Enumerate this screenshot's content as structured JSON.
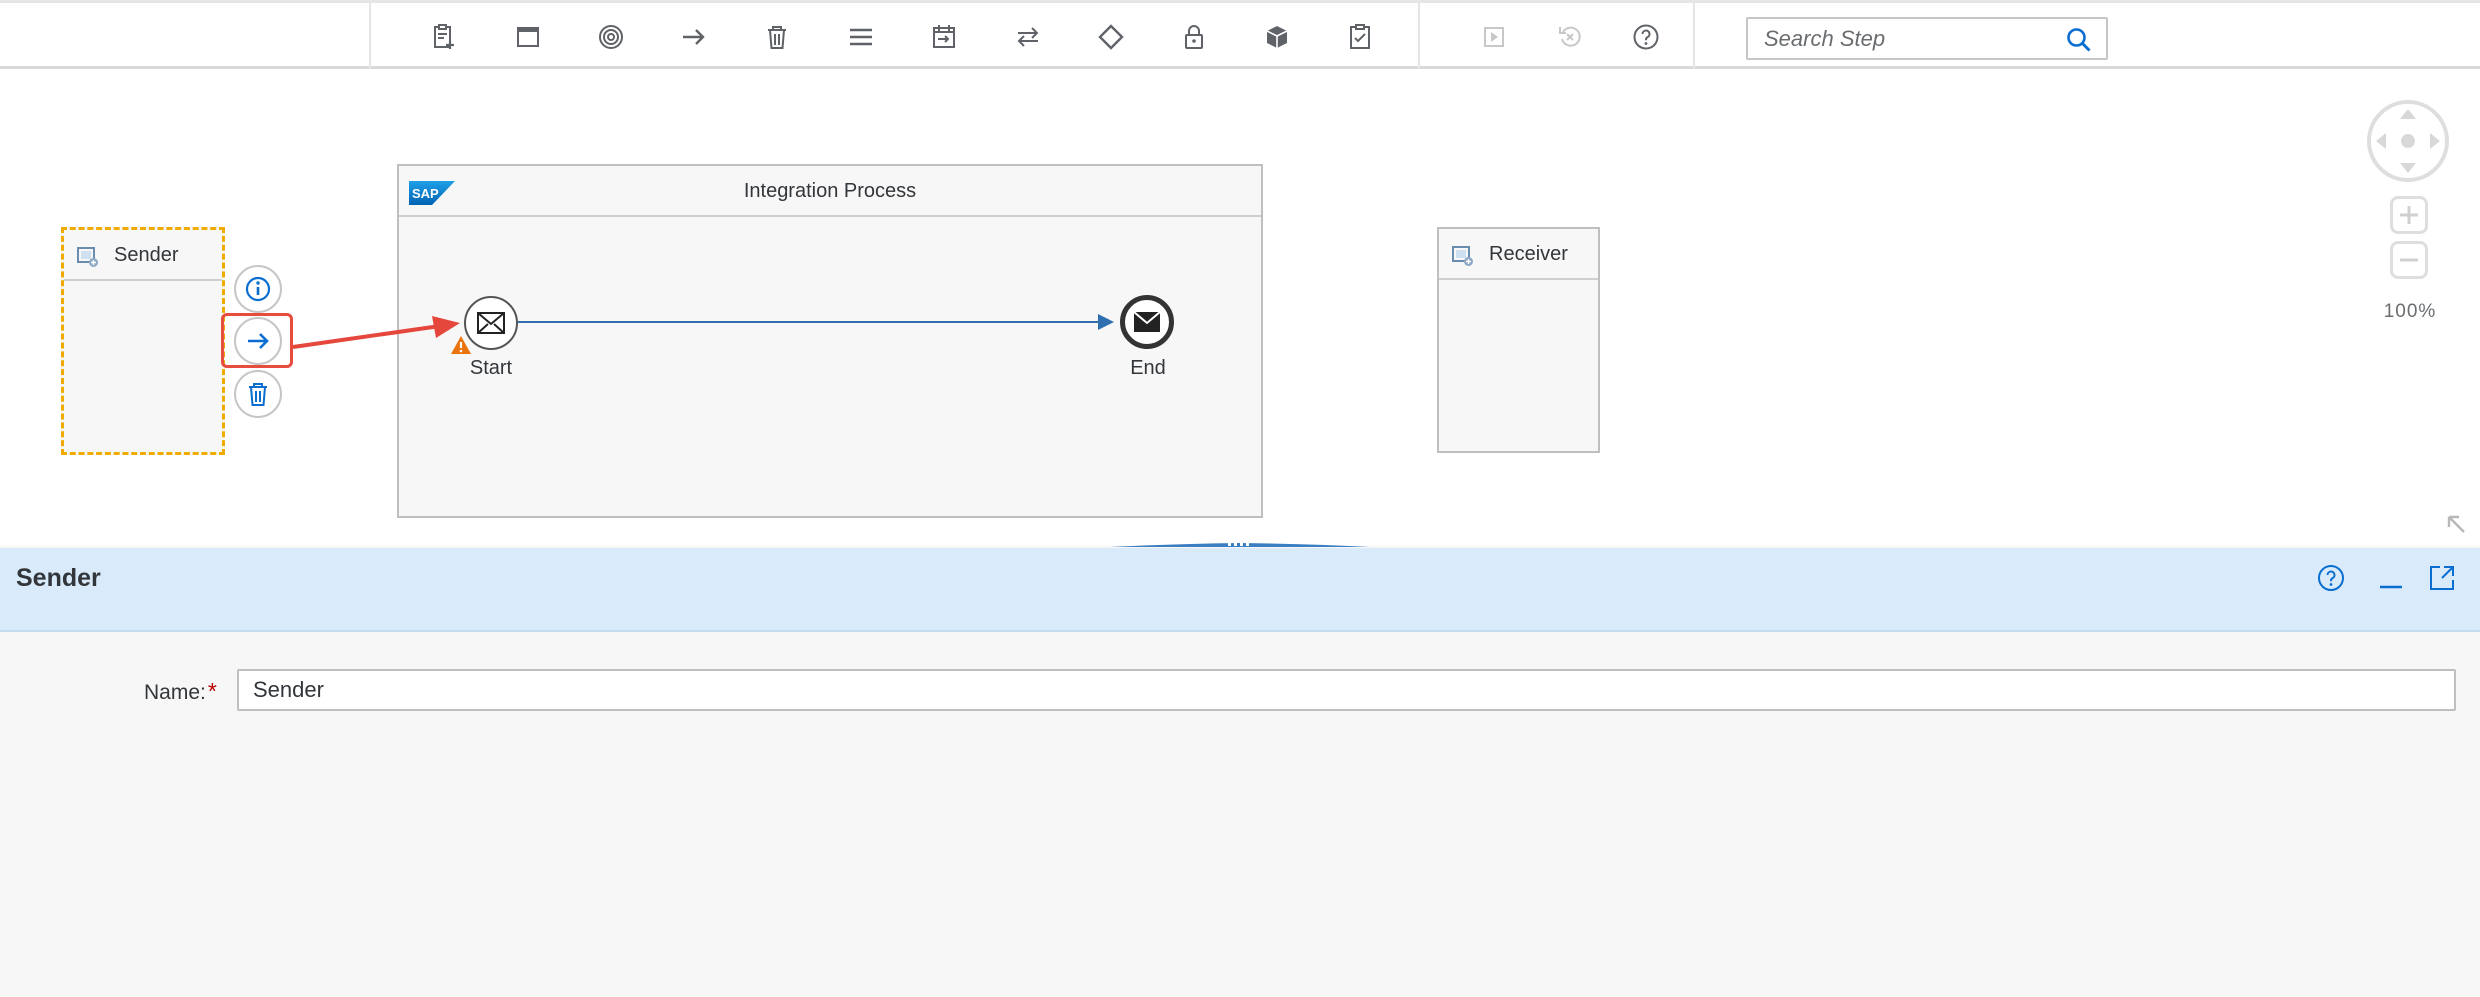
{
  "toolbar": {
    "buttons": [
      {
        "name": "participants-icon",
        "state": "enabled"
      },
      {
        "name": "process-icon",
        "state": "enabled"
      },
      {
        "name": "events-icon",
        "state": "enabled"
      },
      {
        "name": "connector-arrow-icon",
        "state": "enabled"
      },
      {
        "name": "delete-icon",
        "state": "enabled"
      },
      {
        "name": "menu-icon",
        "state": "enabled"
      },
      {
        "name": "call-icon",
        "state": "enabled"
      },
      {
        "name": "mapping-icon",
        "state": "enabled"
      },
      {
        "name": "routing-diamond-icon",
        "state": "enabled"
      },
      {
        "name": "security-lock-icon",
        "state": "enabled"
      },
      {
        "name": "persistence-icon",
        "state": "enabled"
      },
      {
        "name": "validator-clipboard-icon",
        "state": "enabled"
      },
      {
        "name": "simulate-play-icon",
        "state": "disabled"
      },
      {
        "name": "clear-simulation-icon",
        "state": "disabled"
      },
      {
        "name": "help-icon",
        "state": "enabled"
      }
    ],
    "search": {
      "placeholder": "Search Step",
      "value": ""
    }
  },
  "canvas": {
    "integration_process": {
      "title": "Integration Process",
      "logo_text": "SAP"
    },
    "sender": {
      "title": "Sender",
      "selected": true
    },
    "receiver": {
      "title": "Receiver"
    },
    "start_event": {
      "label": "Start",
      "warning": true
    },
    "end_event": {
      "label": "End"
    },
    "context_menu": [
      "info-icon",
      "connect-arrow-icon",
      "delete-icon"
    ],
    "zoom_level": "100%"
  },
  "properties": {
    "title": "Sender",
    "fields": [
      {
        "label": "Name:",
        "required_marker": "*",
        "value": "Sender"
      }
    ]
  },
  "colors": {
    "accent": "#0a6ed1",
    "selection": "#f0ab00",
    "highlight": "#e74c3c",
    "panel_header": "#d9ebfa",
    "warning": "#e9730c"
  }
}
